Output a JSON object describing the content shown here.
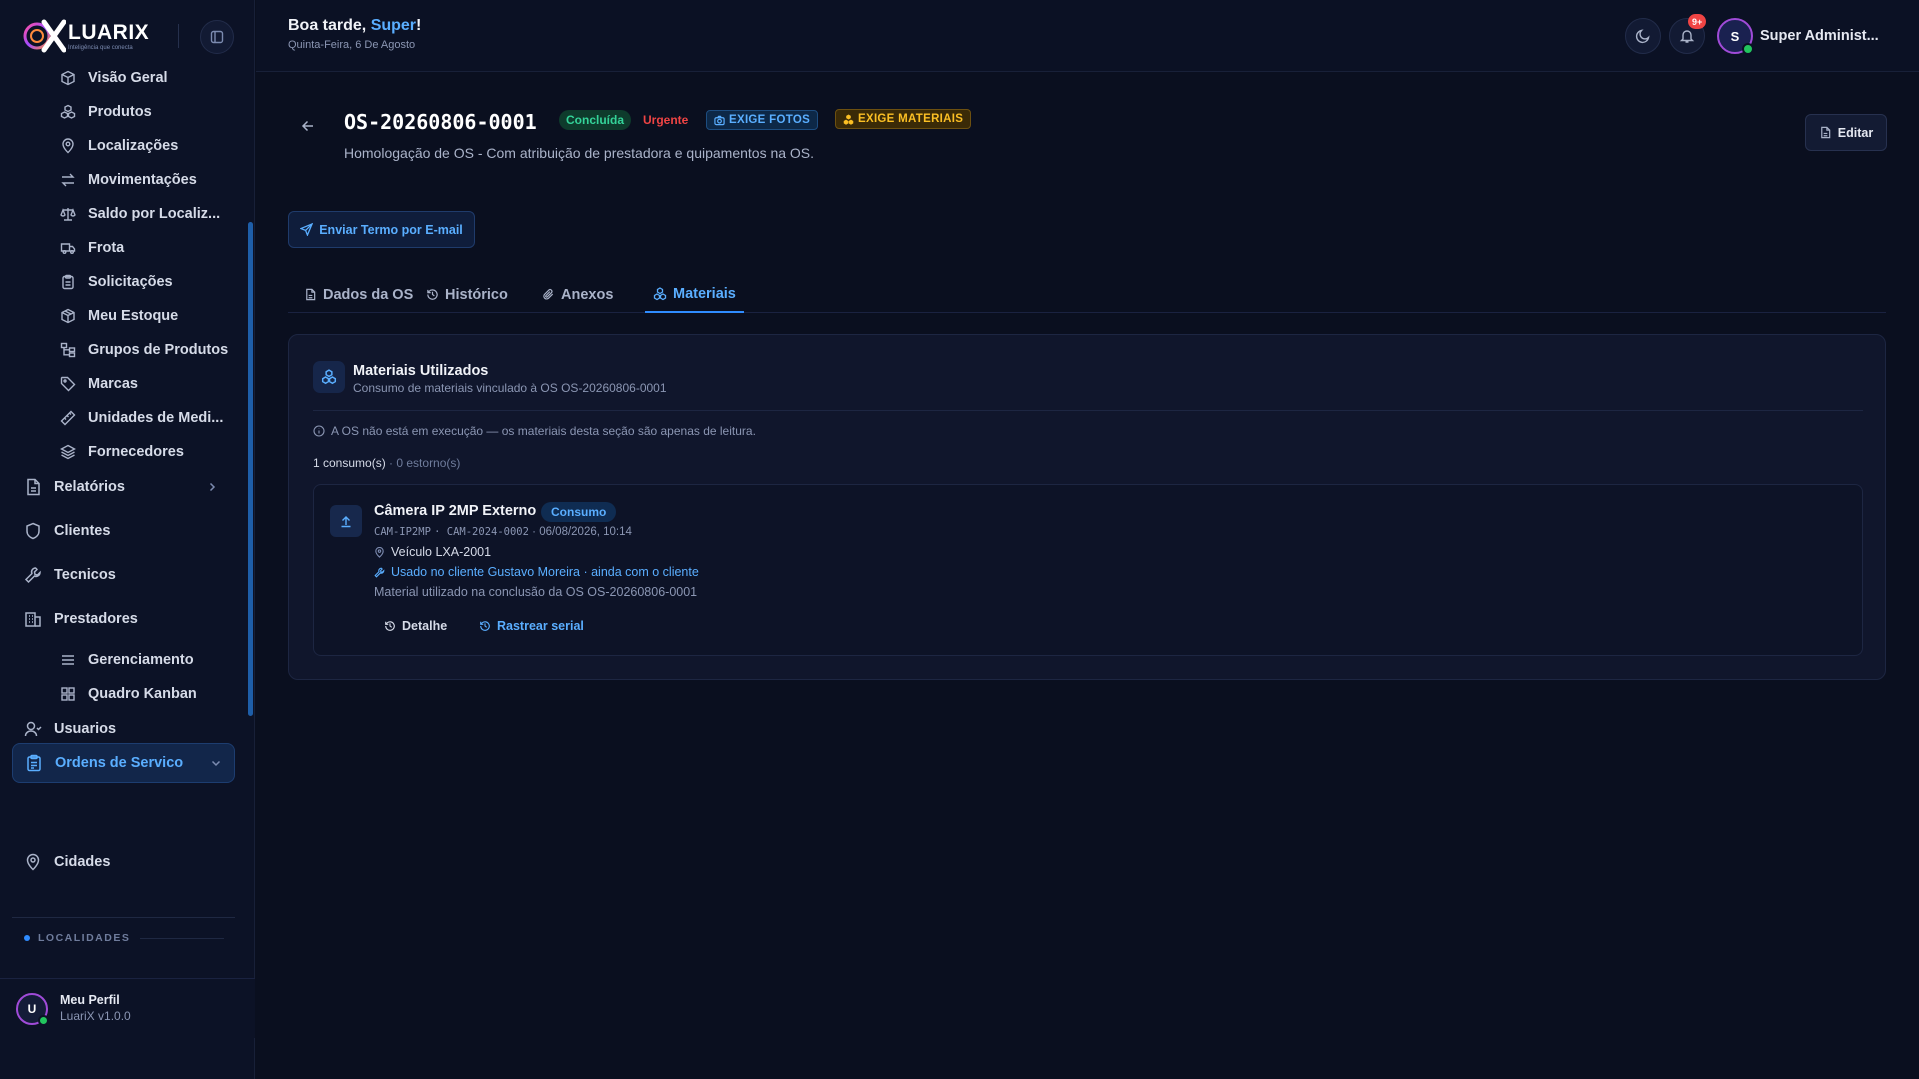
{
  "brand": {
    "name": "LUARIX",
    "tagline": "Inteligência que conecta"
  },
  "sidebar": {
    "sub_items_top": [
      {
        "label": "Visão Geral",
        "icon": "cube-icon"
      },
      {
        "label": "Produtos",
        "icon": "boxes-icon"
      },
      {
        "label": "Localizações",
        "icon": "map-pin-icon"
      },
      {
        "label": "Movimentações",
        "icon": "arrows-exchange-icon"
      },
      {
        "label": "Saldo por Localiz...",
        "icon": "scale-icon"
      },
      {
        "label": "Frota",
        "icon": "truck-icon"
      },
      {
        "label": "Solicitações",
        "icon": "clipboard-icon"
      },
      {
        "label": "Meu Estoque",
        "icon": "package-icon"
      },
      {
        "label": "Grupos de Produtos",
        "icon": "tree-icon"
      },
      {
        "label": "Marcas",
        "icon": "tag-icon"
      },
      {
        "label": "Unidades de Medi...",
        "icon": "ruler-icon"
      },
      {
        "label": "Fornecedores",
        "icon": "layers-icon"
      }
    ],
    "main_items": [
      {
        "label": "Relatórios",
        "icon": "file-icon"
      },
      {
        "label": "Clientes",
        "icon": "shield-icon"
      },
      {
        "label": "Tecnicos",
        "icon": "wrench-icon"
      },
      {
        "label": "Prestadores",
        "icon": "building-icon"
      }
    ],
    "active_item": {
      "label": "Ordens de Servico",
      "icon": "clipboard-list-icon"
    },
    "sub_items_bottom": [
      {
        "label": "Gerenciamento",
        "icon": "list-icon"
      },
      {
        "label": "Quadro Kanban",
        "icon": "grid-icon"
      }
    ],
    "users_item": {
      "label": "Usuarios",
      "icon": "user-icon"
    },
    "section_label": "LOCALIDADES",
    "cities_item": {
      "label": "Cidades",
      "icon": "map-pin-icon"
    },
    "profile": {
      "initial": "U",
      "name": "Meu Perfil",
      "version": "LuariX v1.0.0"
    }
  },
  "topbar": {
    "greeting_prefix": "Boa tarde, ",
    "greeting_name": "Super",
    "greeting_suffix": "!",
    "date": "Quinta-Feira, 6 De Agosto",
    "notification_badge": "9+",
    "user_initial": "S",
    "user_name": "Super Administ..."
  },
  "os": {
    "code": "OS-20260806-0001",
    "status": "Concluída",
    "priority": "Urgente",
    "chip_photos": "EXIGE FOTOS",
    "chip_materials": "EXIGE MATERIAIS",
    "subtitle": "Homologação de OS - Com atribuição de prestadora e quipamentos na OS.",
    "edit_label": "Editar",
    "email_label": "Enviar Termo por E-mail"
  },
  "tabs": [
    {
      "label": "Dados da OS",
      "icon": "document-icon"
    },
    {
      "label": "Histórico",
      "icon": "history-icon"
    },
    {
      "label": "Anexos",
      "icon": "paperclip-icon"
    },
    {
      "label": "Materiais",
      "icon": "boxes-icon",
      "active": true
    }
  ],
  "materials": {
    "title": "Materiais Utilizados",
    "subtitle": "Consumo de materiais vinculado à OS OS-20260806-0001",
    "info": "A OS não está em execução — os materiais desta seção são apenas de leitura.",
    "count_consumos": "1 consumo(s)",
    "count_separator": " · ",
    "count_estornos": "0 estorno(s)",
    "item": {
      "name": "Câmera IP 2MP Externo",
      "type": "Consumo",
      "code": "CAM-IP2MP",
      "serial": "CAM-2024-0002",
      "datetime": "06/08/2026, 10:14",
      "location": "Veículo LXA-2001",
      "client_note": "Usado no cliente Gustavo Moreira · ainda com o cliente",
      "note": "Material utilizado na conclusão da OS OS-20260806-0001",
      "action_detail": "Detalhe",
      "action_serial": "Rastrear serial"
    }
  },
  "colors": {
    "background": "#0a0f1f",
    "accent": "#2f8cff",
    "success": "#34d399",
    "danger": "#ef4444",
    "warning": "#fbbf24"
  }
}
